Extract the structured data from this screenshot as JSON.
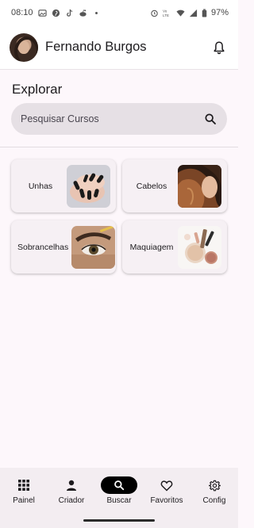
{
  "status_bar": {
    "time": "08:10",
    "left_icons": [
      "gallery-icon",
      "pinterest-icon",
      "tiktok-icon",
      "reddit-icon",
      "dot-icon"
    ],
    "right_icons": [
      "alarm-icon",
      "vowifi-icon",
      "wifi-icon",
      "signal-icon",
      "battery-icon"
    ],
    "battery": "97%"
  },
  "header": {
    "user_name": "Fernando Burgos"
  },
  "explore": {
    "title": "Explorar",
    "search_placeholder": "Pesquisar Cursos"
  },
  "categories": [
    {
      "label": "Unhas",
      "image": "nails-image"
    },
    {
      "label": "Cabelos",
      "image": "hair-image"
    },
    {
      "label": "Sobrancelhas",
      "image": "eyebrows-image"
    },
    {
      "label": "Maquiagem",
      "image": "makeup-image"
    }
  ],
  "bottom_nav": {
    "items": [
      {
        "label": "Painel",
        "icon": "grid-icon"
      },
      {
        "label": "Criador",
        "icon": "person-icon"
      },
      {
        "label": "Buscar",
        "icon": "search-icon"
      },
      {
        "label": "Favoritos",
        "icon": "heart-icon"
      },
      {
        "label": "Config",
        "icon": "gear-icon"
      }
    ],
    "active": "Buscar"
  },
  "colors": {
    "background": "#fdf7fb",
    "search_bg": "#e6e0e5",
    "card_bg": "#f6f0f4",
    "active_nav": "#000000"
  }
}
